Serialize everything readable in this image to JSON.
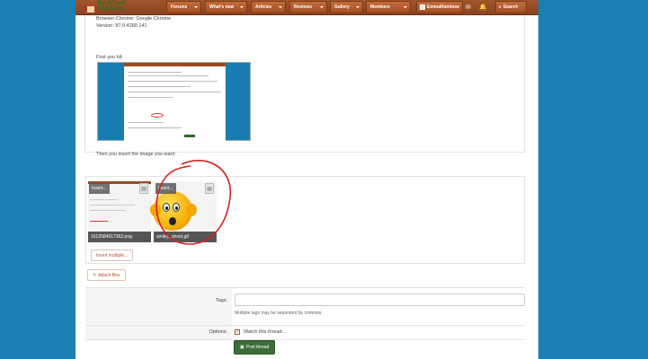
{
  "header": {
    "logo_line1": "BackYard",
    "logo_line2": "Chickens",
    "nav": [
      {
        "label": "Forums"
      },
      {
        "label": "What's new"
      },
      {
        "label": "Articles"
      },
      {
        "label": "Reviews"
      },
      {
        "label": "Gallery"
      },
      {
        "label": "Members"
      }
    ],
    "username": "EmmaRainbow",
    "search_label": "Search"
  },
  "post": {
    "browser_line": "Browser:Chrome: Google Chrome",
    "version_line": "Version: 87.0.4280.141",
    "first_line": "First you hit:",
    "then_line": "Then you insert the image you want:"
  },
  "attachments": [
    {
      "insert_label": "Insert...",
      "filename": "1612584017362.png"
    },
    {
      "insert_label": "Insert...",
      "filename": "smiley_shoot.gif"
    }
  ],
  "buttons": {
    "insert_multiple": "Insert multiple...",
    "attach_files": "Attach files",
    "post_thread": "Post thread"
  },
  "form": {
    "tags_label": "Tags:",
    "tags_value": "",
    "tags_hint": "Multiple tags may be separated by commas.",
    "options_label": "Options:",
    "watch_label": "Watch this thread..."
  },
  "colors": {
    "background": "#1b7fb3",
    "header": "#9a4b24",
    "accent": "#b4532a",
    "post_button": "#3a6e36",
    "annotation": "#d42020"
  }
}
